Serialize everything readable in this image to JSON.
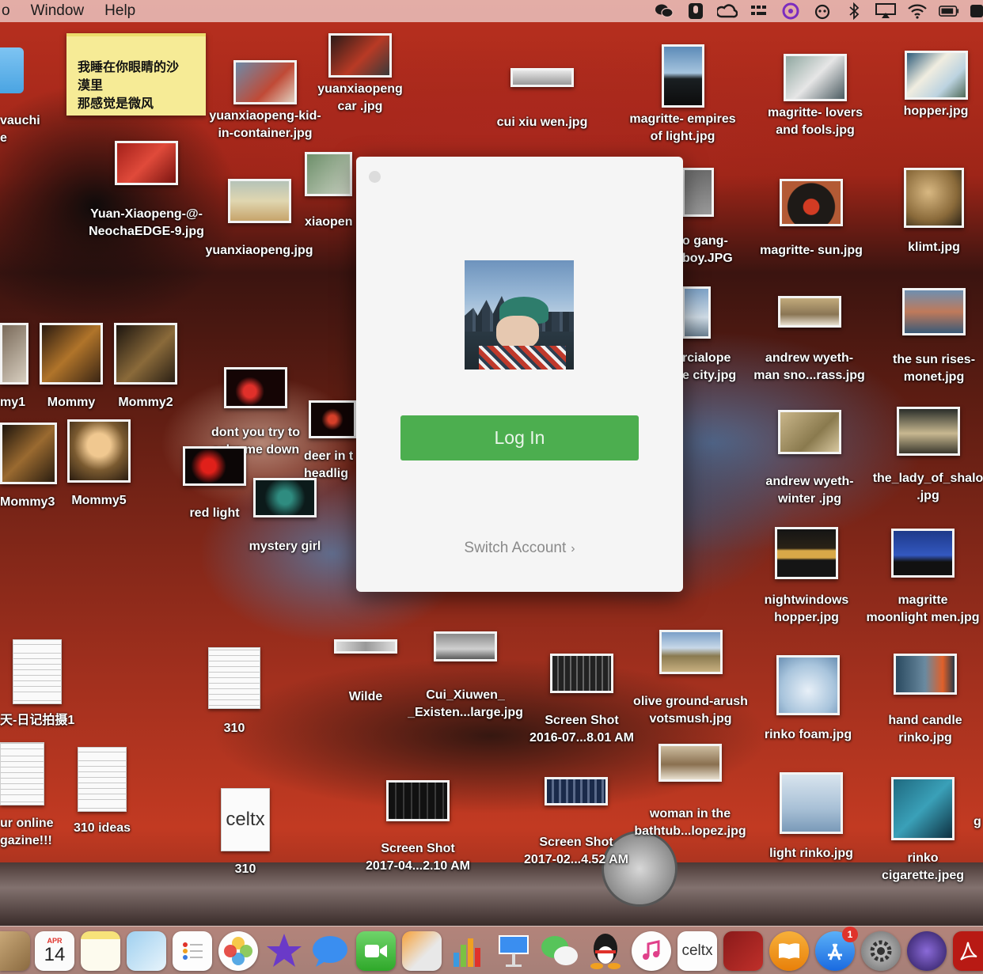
{
  "menubar": {
    "items": [
      "o",
      "Window",
      "Help"
    ],
    "status_icons": [
      "wechat-icon",
      "podcast-mic-icon",
      "creative-cloud-icon",
      "input-method-icon",
      "target-app-icon",
      "cat-face-icon",
      "bluetooth-icon",
      "airplay-icon",
      "wifi-icon",
      "battery-icon",
      "user-icon"
    ]
  },
  "sticky_note": {
    "lines": [
      "我睡在你眼睛的沙",
      "漠里",
      "那感觉是微风"
    ]
  },
  "login_window": {
    "login_label": "Log In",
    "switch_account_label": "Switch Account",
    "switch_chevron": "›"
  },
  "desktop_icons": [
    {
      "label": "vauchi\ne"
    },
    {
      "label": "yuanxiaopeng-kid-\nin-container.jpg"
    },
    {
      "label": "yuanxiaopeng\ncar .jpg"
    },
    {
      "label": "cui xiu wen.jpg"
    },
    {
      "label": "magritte- empires\nof light.jpg"
    },
    {
      "label": "magritte- lovers\nand fools.jpg"
    },
    {
      "label": "hopper.jpg"
    },
    {
      "label": "Yuan-Xiaopeng-@-\nNeochaEDGE-9.jpg"
    },
    {
      "label": "yuanxiaopeng.jpg"
    },
    {
      "label": "xiaopen"
    },
    {
      "label": "o gang-\nboy.JPG"
    },
    {
      "label": "magritte- sun.jpg"
    },
    {
      "label": "klimt.jpg"
    },
    {
      "label": "my1"
    },
    {
      "label": "Mommy"
    },
    {
      "label": "Mommy2"
    },
    {
      "label": "dont you try to\ncalm me down"
    },
    {
      "label": "deer in t\nheadlig"
    },
    {
      "label": "red light"
    },
    {
      "label": "mystery girl"
    },
    {
      "label": "rcialope\ne city.jpg"
    },
    {
      "label": "andrew wyeth-\nman sno...rass.jpg"
    },
    {
      "label": "the sun rises-\nmonet.jpg"
    },
    {
      "label": "Mommy3"
    },
    {
      "label": "Mommy5"
    },
    {
      "label": "andrew wyeth-\nwinter .jpg"
    },
    {
      "label": "the_lady_of_shalo\n.jpg"
    },
    {
      "label": "nightwindows\nhopper.jpg"
    },
    {
      "label": "magritte\nmoonlight men.jpg"
    },
    {
      "label": "天-日记拍摄1"
    },
    {
      "label": "310"
    },
    {
      "label": "Wilde"
    },
    {
      "label": "Cui_Xiuwen_\n_Existen...large.jpg"
    },
    {
      "label": "Screen Shot\n2016-07...8.01 AM"
    },
    {
      "label": "olive ground-arush\nvotsmush.jpg"
    },
    {
      "label": "rinko foam.jpg"
    },
    {
      "label": "hand candle\nrinko.jpg"
    },
    {
      "label": "ur online\ngazine!!!"
    },
    {
      "label": "310 ideas"
    },
    {
      "label": "310"
    },
    {
      "label": "Screen Shot\n2017-04...2.10 AM"
    },
    {
      "label": "woman in the\nbathtub...lopez.jpg"
    },
    {
      "label": "Screen Shot\n2017-02...4.52 AM"
    },
    {
      "label": "light rinko.jpg"
    },
    {
      "label": "rinko\ncigarette.jpeg"
    },
    {
      "label": "g"
    }
  ],
  "celtx_label": "celtx",
  "dock": {
    "calendar_month": "APR",
    "calendar_day": "14",
    "celtx_label": "celtx",
    "appstore_badge": "1",
    "apps": [
      "finder-icon",
      "calendar-icon",
      "notes-icon",
      "preview-icon",
      "reminders-icon",
      "photos-icon",
      "imovie-icon",
      "messages-icon",
      "facetime-icon",
      "pages-icon",
      "numbers-icon",
      "keynote-icon",
      "wechat-icon",
      "qq-icon",
      "itunes-icon",
      "celtx-icon",
      "photo-booth-icon",
      "ibooks-icon",
      "app-store-icon",
      "system-preferences-icon",
      "dvd-player-icon",
      "acrobat-icon"
    ]
  },
  "colors": {
    "login_green": "#4cae4f",
    "window_bg": "#f5f5f5",
    "menubar_bg": "#e8beb9",
    "sticky_yellow": "#f6eb96"
  }
}
